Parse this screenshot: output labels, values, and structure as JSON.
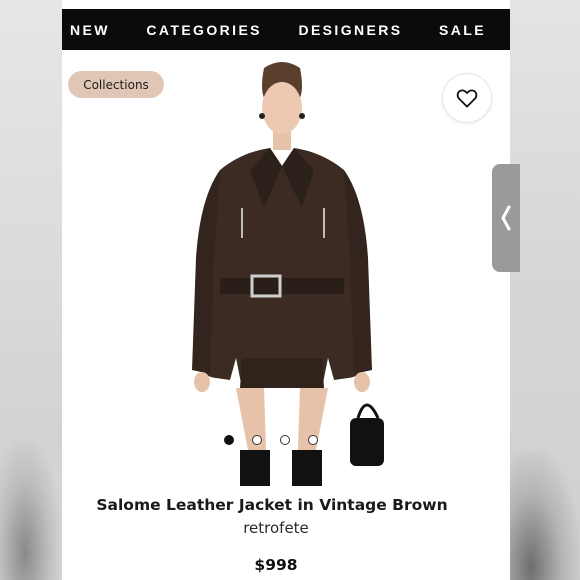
{
  "nav": {
    "items": [
      {
        "label": "NEW"
      },
      {
        "label": "CATEGORIES"
      },
      {
        "label": "DESIGNERS"
      },
      {
        "label": "SALE"
      }
    ]
  },
  "badge": {
    "label": "Collections"
  },
  "product": {
    "name": "Salome Leather Jacket in Vintage Brown",
    "designer": "retrofete",
    "price": "$998"
  },
  "carousel": {
    "total": 4,
    "active_index": 0
  },
  "icons": {
    "favorite": "heart-icon",
    "side_tab": "chevron-left-icon"
  },
  "colors": {
    "nav_bg": "#0b0b0b",
    "badge_bg": "#e0c6b4",
    "jacket": "#3b2b22"
  }
}
